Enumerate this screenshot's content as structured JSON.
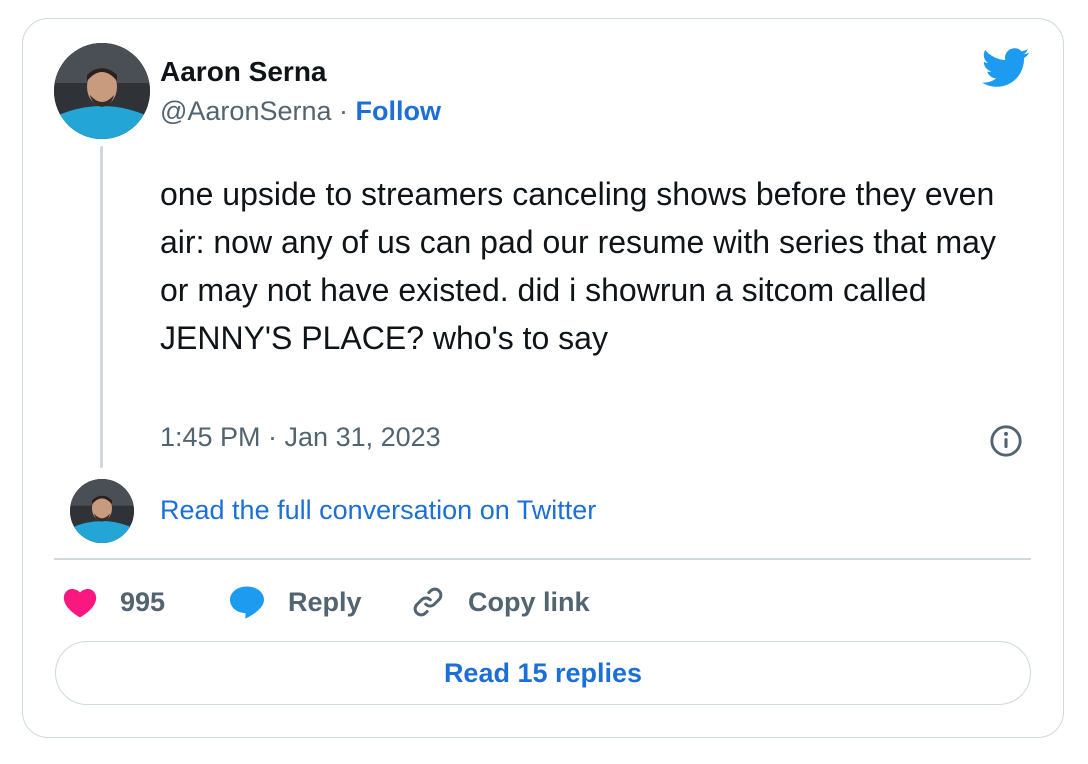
{
  "author": {
    "name": "Aaron Serna",
    "handle": "@AaronSerna",
    "separator": " · ",
    "follow_label": "Follow"
  },
  "tweet": {
    "text": "one upside to streamers canceling shows before they even air: now any of us can pad our resume with series that may or may not have existed. did i showrun a sitcom called JENNY'S PLACE? who's to say",
    "timestamp": "1:45 PM · Jan 31, 2023"
  },
  "conversation_link": "Read the full conversation on Twitter",
  "actions": {
    "like_count": "995",
    "reply_label": "Reply",
    "copy_label": "Copy link"
  },
  "read_replies_label": "Read 15 replies",
  "colors": {
    "link_blue": "#1d6fd8",
    "twitter_blue": "#1d9bf0",
    "like_pink": "#f91880",
    "muted_text": "#536471",
    "border": "#cfd9de"
  },
  "icons": [
    "twitter-bird-icon",
    "info-icon",
    "heart-icon",
    "reply-bubble-icon",
    "link-icon"
  ]
}
